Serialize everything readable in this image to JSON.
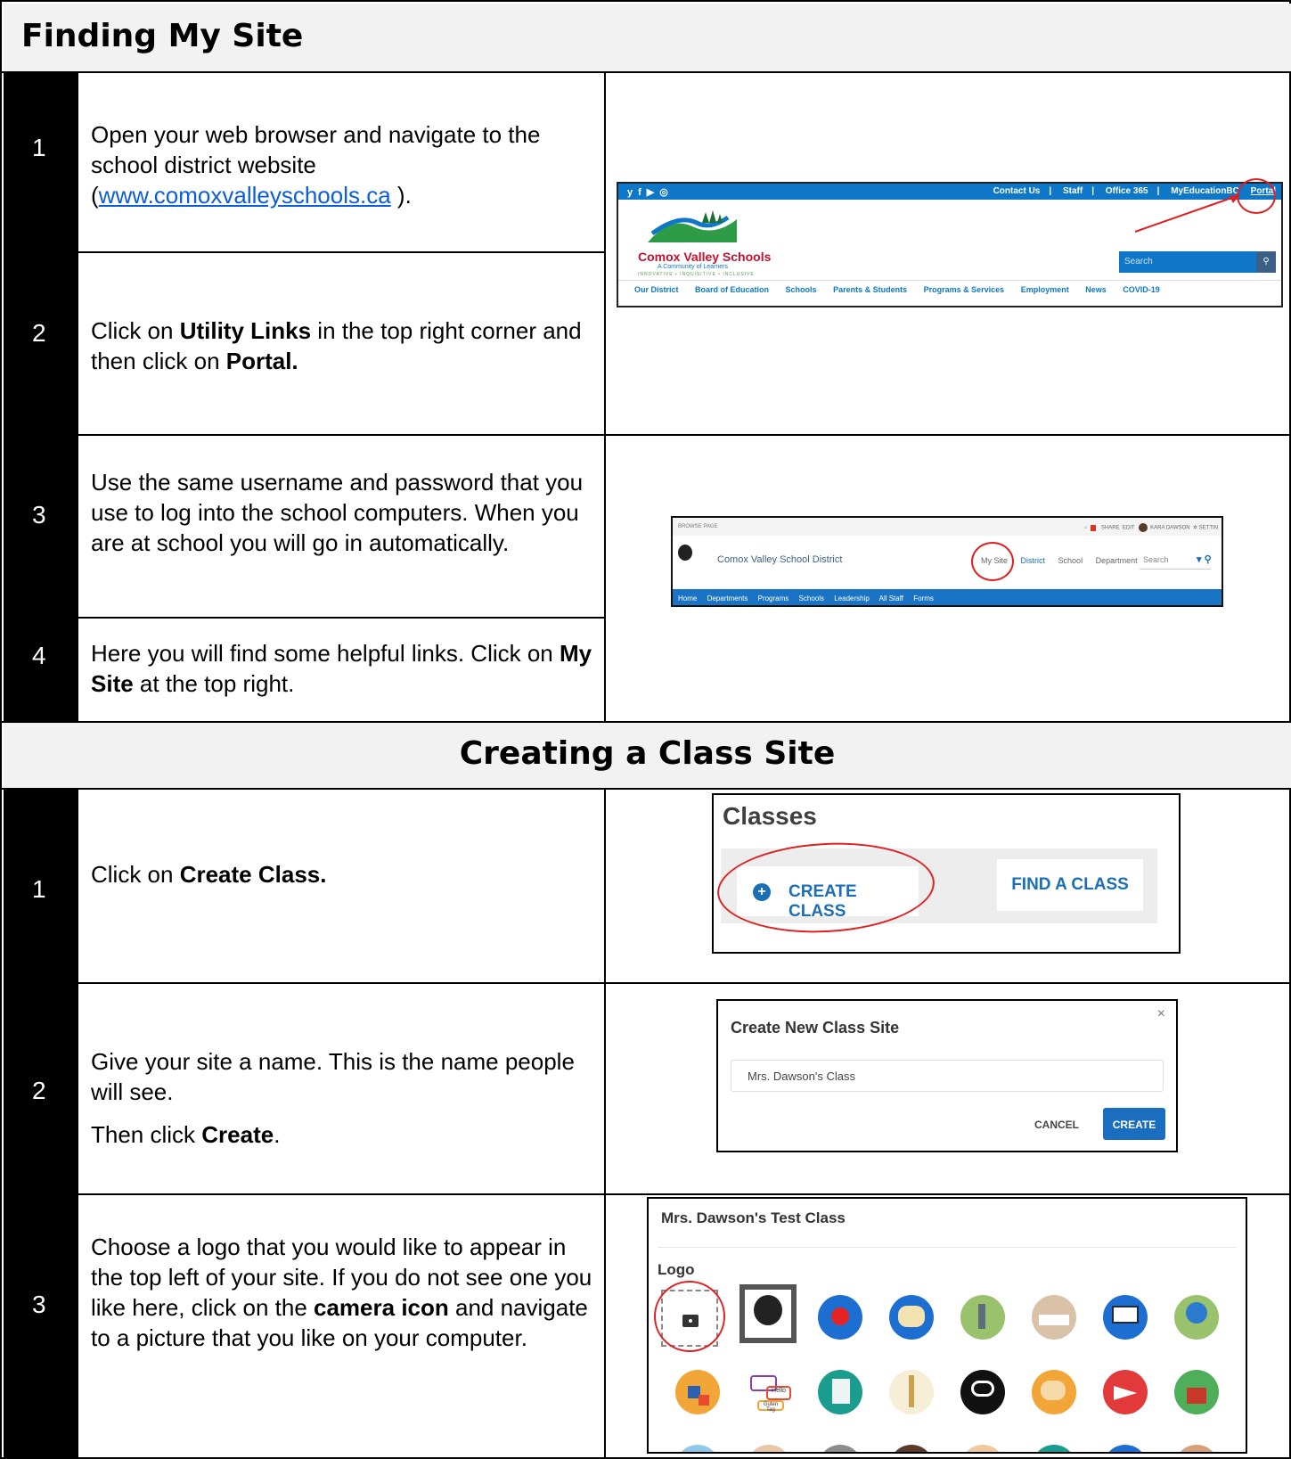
{
  "section1": {
    "title": "Finding My Site",
    "steps": [
      {
        "num": "1",
        "text_a": "Open your web browser and navigate to the school district website (",
        "link": "www.comoxvalleyschools.ca",
        "text_b": " )."
      },
      {
        "num": "2",
        "text_a": "Click on ",
        "bold_a": "Utility Links",
        "text_b": " in the top right corner and then click on ",
        "bold_b": "Portal."
      },
      {
        "num": "3",
        "text": "Use the same username and password that you use to log into the school computers. When you are at school you will go in automatically."
      },
      {
        "num": "4",
        "text_a": "Here you will find some helpful links. Click on ",
        "bold": "My Site",
        "text_b": " at the top right."
      }
    ]
  },
  "section2": {
    "title": "Creating a Class Site",
    "steps": [
      {
        "num": "1",
        "text_a": "Click on ",
        "bold": "Create Class."
      },
      {
        "num": "2",
        "text": "Give your site a name.  This is the name people will see.",
        "text_c": "Then click ",
        "bold": "Create",
        "text_d": "."
      },
      {
        "num": "3",
        "text_a": "Choose a logo that you would like to appear in the top left of your site.  If you do not see one you like here, click on the ",
        "bold": "camera icon",
        "text_b": " and navigate to a picture that you like on your computer."
      }
    ]
  },
  "website_shot": {
    "social_icons": [
      "twitter-icon",
      "facebook-icon",
      "youtube-icon",
      "instagram-icon"
    ],
    "utility_links": [
      "Contact Us",
      "Staff",
      "Office 365",
      "MyEducationBC",
      "Portal"
    ],
    "school_name": "Comox Valley Schools",
    "tagline": "A Community of Learners",
    "motto": "INNOVATIVE • INQUISITIVE • INCLUSIVE",
    "search_placeholder": "Search",
    "nav": [
      "Our District",
      "Board of Education",
      "Schools",
      "Parents & Students",
      "Programs & Services",
      "Employment",
      "News",
      "COVID-19"
    ],
    "brand_color": "#0e77c8"
  },
  "portal_shot": {
    "top_left": "BROWSE    PAGE",
    "top_right": [
      "SHARE",
      "EDIT",
      "KARA DAWSON",
      "SETTIN"
    ],
    "site_title": "Comox Valley School District",
    "links": [
      "My Site",
      "District",
      "School",
      "Department"
    ],
    "search_placeholder": "Search",
    "menu": [
      "Home",
      "Departments",
      "Programs",
      "Schools",
      "Leadership",
      "All Staff",
      "Forms"
    ]
  },
  "classes_shot": {
    "title": "Classes",
    "create_label": "CREATE CLASS",
    "find_label": "FIND A CLASS"
  },
  "dialog_shot": {
    "title": "Create New Class Site",
    "close": "×",
    "input_value": "Mrs. Dawson's Class",
    "cancel_label": "CANCEL",
    "create_label": "CREATE"
  },
  "logo_shot": {
    "title": "Mrs. Dawson's Test Class",
    "logo_label": "Logo",
    "icons_row1": [
      "apple-icon",
      "art-palette-icon",
      "microscope-icon",
      "books-icon",
      "computer-icon",
      "globe-icon"
    ],
    "icons_row2": [
      "abc-blocks-icon",
      "speech-bubbles-icon",
      "calculator-icon",
      "music-icon",
      "formline-art-icon",
      "paint-palette-icon",
      "paper-plane-icon",
      "schoolhouse-icon"
    ],
    "bubble_text": [
      "Hello",
      "Guten Tag"
    ],
    "accent": "#e02020"
  }
}
